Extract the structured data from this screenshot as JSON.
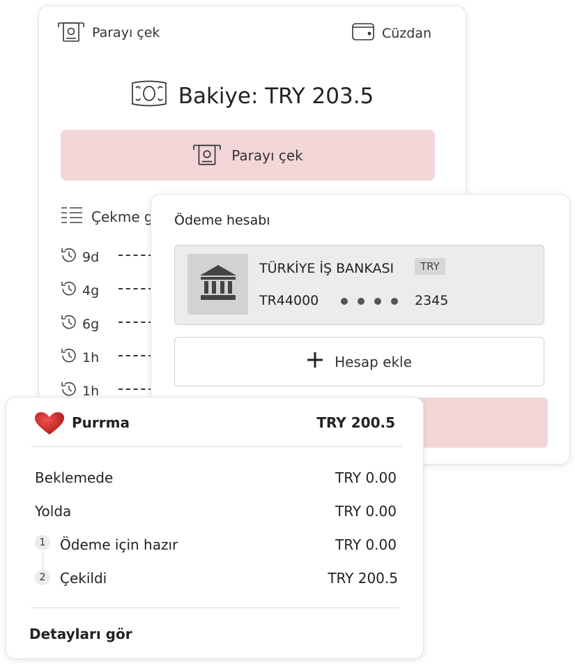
{
  "withdraw_card": {
    "withdraw_link_label": "Parayı çek",
    "wallet_link_label": "Cüzdan",
    "balance_text": "Bakiye: TRY 203.5",
    "withdraw_button_label": "Parayı çek",
    "history_title": "Çekme g",
    "history": [
      {
        "label": "9d"
      },
      {
        "label": "4g"
      },
      {
        "label": "6g"
      },
      {
        "label": "1h"
      },
      {
        "label": "1h"
      }
    ]
  },
  "payment_card": {
    "title": "Ödeme hesabı",
    "account": {
      "bank_name": "TÜRKİYE İŞ BANKASI",
      "currency_badge": "TRY",
      "iban_prefix": "TR44000",
      "iban_suffix": "2345"
    },
    "add_account_label": "Hesap ekle"
  },
  "summary_card": {
    "merchant_name": "Purrma",
    "merchant_total": "TRY 200.5",
    "rows": [
      {
        "label": "Beklemede",
        "value": "TRY 0.00"
      },
      {
        "label": "Yolda",
        "value": "TRY 0.00"
      }
    ],
    "steps": [
      {
        "number": "1",
        "label": "Ödeme için hazır",
        "value": "TRY 0.00"
      },
      {
        "number": "2",
        "label": "Çekildi",
        "value": "TRY 200.5"
      }
    ],
    "details_link": "Detayları gör"
  },
  "colors": {
    "accent_pink": "#f3d6d8",
    "heart_red": "#d42a2a",
    "account_box_bg": "#ececec"
  },
  "icons": [
    "atm-withdraw-icon",
    "wallet-icon",
    "banknote-icon",
    "list-icon",
    "history-icon",
    "bank-icon",
    "plus-icon",
    "heart-icon"
  ]
}
